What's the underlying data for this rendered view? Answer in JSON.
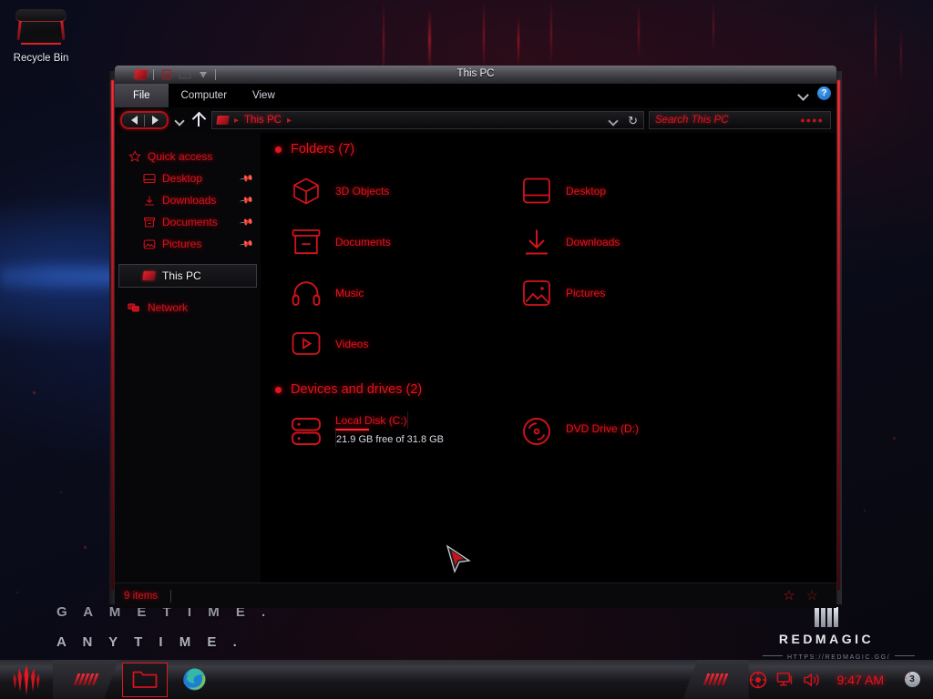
{
  "desktop": {
    "recycle_bin_label": "Recycle Bin",
    "recycle_bin_icon": "recycle-bin-icon",
    "wallpaper_line1": "G A M E T I M E .",
    "wallpaper_line2": "A N Y T I M E .",
    "brand_name": "REDMAGIC",
    "brand_url": "HTTPS://REDMAGIC.GG/"
  },
  "window": {
    "title": "This PC",
    "quick_access_toolbar": [
      {
        "name": "app-icon",
        "icon": "this-pc-icon"
      },
      {
        "name": "properties-button",
        "icon": "properties-icon"
      },
      {
        "name": "new-folder-button",
        "icon": "new-folder-icon"
      },
      {
        "name": "customize-toolbar-button",
        "icon": "chevron-down-icon"
      }
    ],
    "ribbon_tabs": [
      {
        "label": "File",
        "active": true
      },
      {
        "label": "Computer",
        "active": false
      },
      {
        "label": "View",
        "active": false
      }
    ],
    "ribbon_collapse_icon": "chevron-down-icon",
    "help_label": "?",
    "nav": {
      "back_icon": "back-arrow-icon",
      "forward_icon": "forward-arrow-icon",
      "recent_icon": "chevron-down-icon",
      "up_icon": "up-arrow-icon"
    },
    "address": {
      "icon": "this-pc-icon",
      "crumb": "This PC",
      "dropdown_icon": "chevron-down-icon",
      "refresh_icon": "refresh-icon"
    },
    "search": {
      "placeholder": "Search This PC",
      "icon": "search-icon"
    },
    "statusbar": {
      "items_text": "9 items",
      "view_buttons": [
        {
          "name": "details-view-button",
          "icon": "star-icon"
        },
        {
          "name": "large-icons-view-button",
          "icon": "star-icon"
        }
      ]
    }
  },
  "sidebar": {
    "items": [
      {
        "label": "Quick access",
        "icon": "star-icon",
        "level": "root",
        "pinned": false,
        "selected": false
      },
      {
        "label": "Desktop",
        "icon": "desktop-icon",
        "level": "child",
        "pinned": true,
        "selected": false
      },
      {
        "label": "Downloads",
        "icon": "downloads-icon",
        "level": "child",
        "pinned": true,
        "selected": false
      },
      {
        "label": "Documents",
        "icon": "documents-icon",
        "level": "child",
        "pinned": true,
        "selected": false
      },
      {
        "label": "Pictures",
        "icon": "pictures-icon",
        "level": "child",
        "pinned": true,
        "selected": false
      },
      {
        "label": "This PC",
        "icon": "this-pc-icon",
        "level": "root",
        "pinned": false,
        "selected": true
      },
      {
        "label": "Network",
        "icon": "network-icon",
        "level": "root",
        "pinned": false,
        "selected": false
      }
    ]
  },
  "content": {
    "groups": [
      {
        "title": "Folders (7)",
        "items": [
          {
            "label": "3D Objects",
            "icon": "3d-objects-icon"
          },
          {
            "label": "Desktop",
            "icon": "desktop-icon"
          },
          {
            "label": "Documents",
            "icon": "documents-icon"
          },
          {
            "label": "Downloads",
            "icon": "downloads-icon"
          },
          {
            "label": "Music",
            "icon": "music-icon"
          },
          {
            "label": "Pictures",
            "icon": "pictures-icon"
          },
          {
            "label": "Videos",
            "icon": "videos-icon"
          }
        ]
      },
      {
        "title": "Devices and drives (2)",
        "drives": [
          {
            "label": "Local Disk (C:)",
            "icon": "hard-drive-icon",
            "free_text": "21.9 GB free of 31.8 GB",
            "used_percent": 31,
            "has_bar": true
          },
          {
            "label": "DVD Drive (D:)",
            "icon": "optical-drive-icon",
            "free_text": "",
            "used_percent": 0,
            "has_bar": false
          }
        ]
      }
    ]
  },
  "taskbar": {
    "start_icon": "start-logo-icon",
    "search_icon": "search-wedge-icon",
    "buttons": [
      {
        "name": "taskbar-file-explorer",
        "icon": "folder-icon",
        "active": true
      },
      {
        "name": "taskbar-edge-browser",
        "icon": "edge-icon",
        "active": false
      }
    ],
    "tray": [
      {
        "name": "tray-redmagic-icon",
        "icon": "target-icon"
      },
      {
        "name": "tray-network-icon",
        "icon": "network-monitor-icon"
      },
      {
        "name": "tray-volume-icon",
        "icon": "speaker-icon"
      }
    ],
    "clock": "9:47 AM",
    "notification_count": "3",
    "notification_icon": "notification-icon"
  },
  "colors": {
    "accent_red": "#e0141e",
    "bright_red": "#ff2b35",
    "window_bg": "#000000",
    "frame_gray": "#2a2a30"
  }
}
